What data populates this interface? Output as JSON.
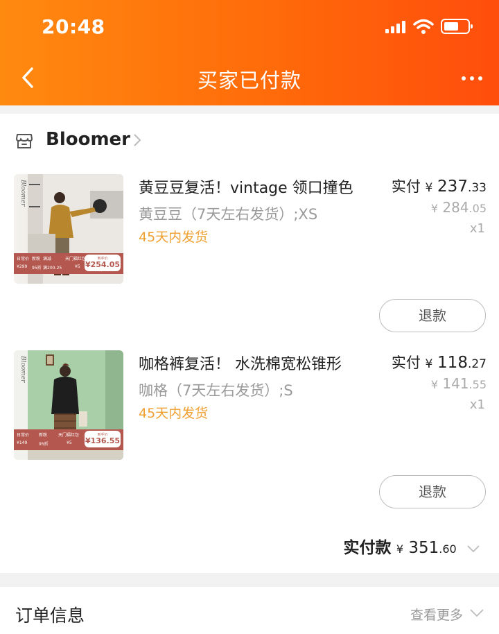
{
  "status_bar": {
    "time": "20:48"
  },
  "nav": {
    "title": "买家已付款"
  },
  "shop": {
    "name": "Bloomer"
  },
  "items": [
    {
      "title": "黄豆豆复活！vintage 领口撞色",
      "sku": "黄豆豆（7天左右发货）;XS",
      "shipping": "45天内发货",
      "paid_label": "实付",
      "paid_currency": "¥",
      "paid_int": "237",
      "paid_dec": ".33",
      "orig_currency": "¥",
      "orig_int": "284",
      "orig_dec": ".05",
      "qty": "x1",
      "refund_label": "退款",
      "thumb": {
        "brand": "Bloomer",
        "strip": [
          "日常价",
          "¥299",
          "新粉",
          "95折",
          "满减",
          "满200-25",
          "天门福红包",
          "¥5"
        ],
        "tag_top": "到手价",
        "tag_price": "¥254.05"
      }
    },
    {
      "title": "咖格裤复活！ 水洗棉宽松锥形",
      "sku": "咖格（7天左右发货）;S",
      "shipping": "45天内发货",
      "paid_label": "实付",
      "paid_currency": "¥",
      "paid_int": "118",
      "paid_dec": ".27",
      "orig_currency": "¥",
      "orig_int": "141",
      "orig_dec": ".55",
      "qty": "x1",
      "refund_label": "退款",
      "thumb": {
        "brand": "Bloomer",
        "strip": [
          "日常价",
          "¥149",
          "新粉",
          "95折",
          "天门福红包",
          "¥5"
        ],
        "tag_top": "到手价",
        "tag_price": "¥136.55"
      }
    }
  ],
  "total": {
    "label": "实付款",
    "currency": "¥",
    "int": "351",
    "dec": ".60"
  },
  "order_info": {
    "title": "订单信息",
    "more": "查看更多"
  },
  "colors": {
    "header_start": "#ff8a10",
    "header_end": "#ff4d0c",
    "shipping": "#f0a030",
    "thumb_strip": "#b4584f"
  }
}
